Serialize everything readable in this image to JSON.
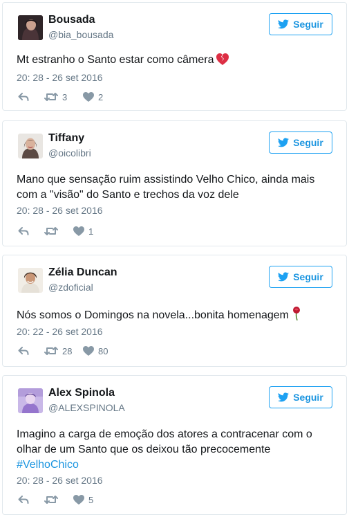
{
  "colors": {
    "accent": "#1da1f2",
    "link": "#1b95e0",
    "muted": "#657786",
    "text": "#14171a",
    "border": "#e1e8ed"
  },
  "tweets": [
    {
      "name": "Bousada",
      "handle": "@bia_bousada",
      "follow_label": "Seguir",
      "text": "Mt estranho o Santo estar como câmera",
      "emoji": "broken-heart-icon",
      "time": "20: 28 - 26 set 2016",
      "retweets": "3",
      "likes": "2"
    },
    {
      "name": "Tiffany",
      "handle": "@oicolibri",
      "follow_label": "Seguir",
      "text_line1": "Mano que sensação ruim assistindo Velho Chico, ainda mais",
      "text_line2": "com a \"visão\" do Santo e trechos da voz dele",
      "time": "20: 28 - 26 set 2016",
      "retweets": "",
      "likes": "1"
    },
    {
      "name": "Zélia Duncan",
      "handle": "@zdoficial",
      "follow_label": "Seguir",
      "text": "Nós somos o Domingos na novela...bonita homenagem",
      "emoji": "rose-icon",
      "time": "20: 22 - 26 set 2016",
      "retweets": "28",
      "likes": "80"
    },
    {
      "name": "Alex Spinola",
      "handle": "@ALEXSPINOLA",
      "follow_label": "Seguir",
      "text_line1": "Imagino a carga de emoção dos atores a contracenar com o",
      "text_line2": "olhar de um Santo que os deixou tão precocemente",
      "hashtag": "#VelhoChico",
      "time": "20: 28 - 26 set 2016",
      "retweets": "",
      "likes": "5"
    }
  ]
}
